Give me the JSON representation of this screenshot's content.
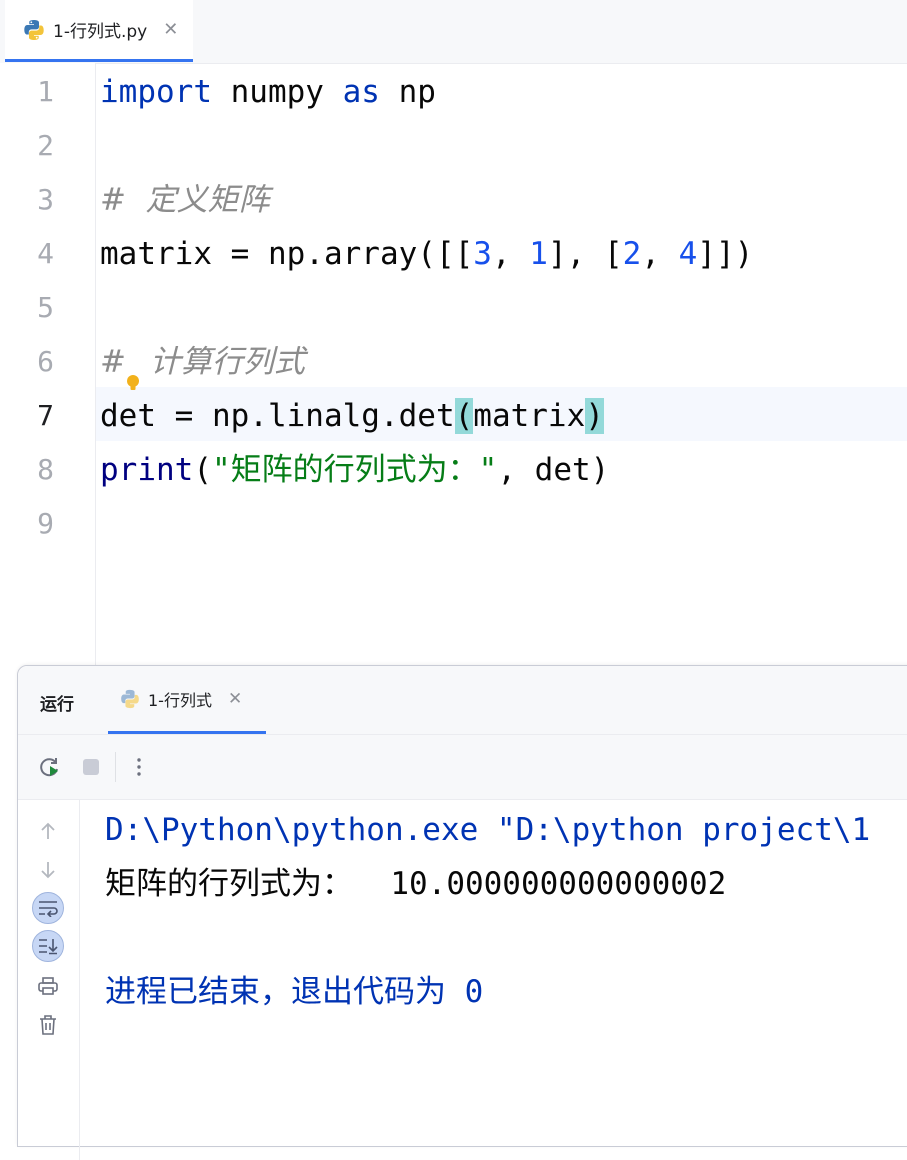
{
  "editor": {
    "tab": {
      "label": "1-行列式.py"
    },
    "lines": [
      {
        "num": "1",
        "parts": [
          {
            "t": "import",
            "c": "kw"
          },
          {
            "t": " numpy ",
            "c": ""
          },
          {
            "t": "as",
            "c": "kw"
          },
          {
            "t": " np",
            "c": ""
          }
        ]
      },
      {
        "num": "2",
        "parts": []
      },
      {
        "num": "3",
        "parts": [
          {
            "t": "#  定义矩阵",
            "c": "comment"
          }
        ]
      },
      {
        "num": "4",
        "parts": [
          {
            "t": "matrix = np.array([[",
            "c": ""
          },
          {
            "t": "3",
            "c": "num"
          },
          {
            "t": ", ",
            "c": ""
          },
          {
            "t": "1",
            "c": "num"
          },
          {
            "t": "], [",
            "c": ""
          },
          {
            "t": "2",
            "c": "num"
          },
          {
            "t": ", ",
            "c": ""
          },
          {
            "t": "4",
            "c": "num"
          },
          {
            "t": "]])",
            "c": ""
          }
        ]
      },
      {
        "num": "5",
        "parts": []
      },
      {
        "num": "6",
        "parts": [
          {
            "t": "#",
            "c": "comment"
          },
          {
            "t": "BULB",
            "c": "bulb"
          },
          {
            "t": " 计算行列式",
            "c": "comment"
          }
        ]
      },
      {
        "num": "7",
        "parts": [
          {
            "t": "det = np.linalg.det",
            "c": ""
          },
          {
            "t": "(",
            "c": "brace-match"
          },
          {
            "t": "matrix",
            "c": ""
          },
          {
            "t": ")",
            "c": "brace-match"
          }
        ]
      },
      {
        "num": "8",
        "parts": [
          {
            "t": "print",
            "c": "builtin"
          },
          {
            "t": "(",
            "c": ""
          },
          {
            "t": "\"矩阵的行列式为：\"",
            "c": "str"
          },
          {
            "t": ", det)",
            "c": ""
          }
        ]
      },
      {
        "num": "9",
        "parts": []
      }
    ],
    "active_line": "7"
  },
  "run_panel": {
    "title": "运行",
    "tab": {
      "label": "1-行列式"
    },
    "console": [
      {
        "text": "D:\\Python\\python.exe \"D:\\python project\\1",
        "color": "c-blue"
      },
      {
        "text": "矩阵的行列式为：  10.000000000000002",
        "color": "c-black"
      },
      {
        "text": "",
        "color": "c-black"
      },
      {
        "text": "进程已结束，退出代码为 0",
        "color": "c-blue"
      }
    ]
  },
  "icons": {
    "editor_tab": "python-icon",
    "run_tab": "python-icon",
    "toolbar": [
      "rerun-icon",
      "stop-icon",
      "more-vertical-icon"
    ],
    "sidebar": [
      "scroll-up-icon",
      "scroll-down-icon",
      "soft-wrap-icon",
      "scroll-to-end-icon",
      "print-icon",
      "trash-icon"
    ]
  },
  "colors": {
    "accent": "#3574f0",
    "keyword": "#0033b3",
    "number": "#1750eb",
    "string": "#067d17",
    "comment": "#8c8c8c",
    "brace_match": "#93d9d9"
  }
}
